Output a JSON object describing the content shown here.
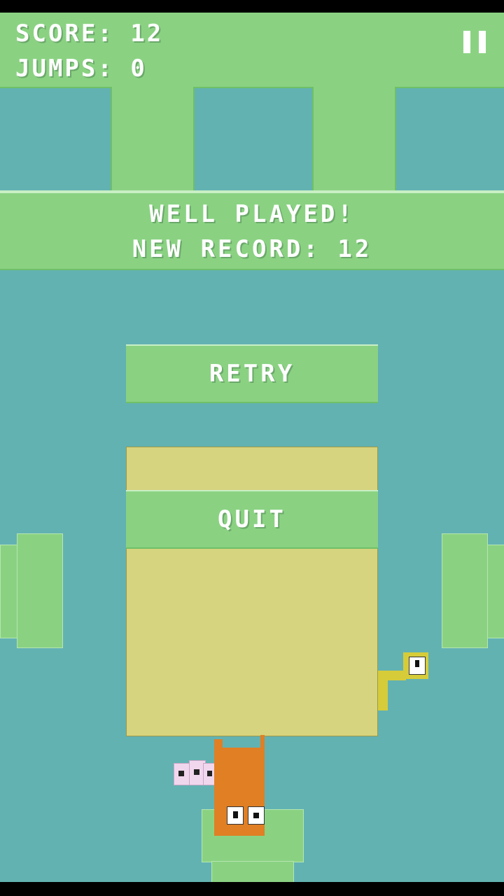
{
  "hud": {
    "score_label": "SCORE:",
    "score_value": "12",
    "jumps_label": "JUMPS:",
    "jumps_value": "0"
  },
  "banner": {
    "line1": "WELL PLAYED!",
    "line2_label": "NEW RECORD:",
    "line2_value": "12"
  },
  "buttons": {
    "retry": "RETRY",
    "quit": "QUIT"
  },
  "icons": {
    "pause": "pause-icon"
  },
  "colors": {
    "sky": "#62b2b2",
    "green": "#8ad282",
    "panel": "#d6d47e",
    "orange": "#e07f24",
    "yellow": "#d6cc3a"
  }
}
